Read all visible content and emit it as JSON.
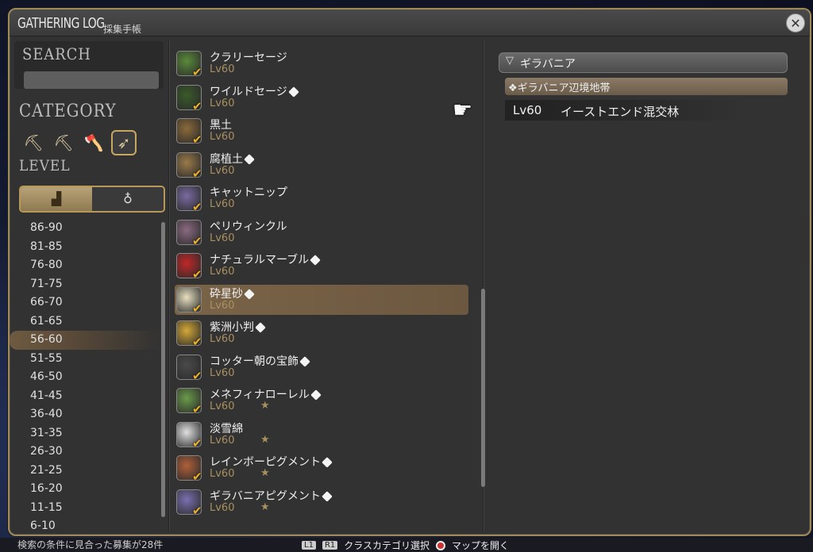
{
  "window": {
    "title": "GATHERING LOG",
    "subtitle": "採集手帳",
    "close_icon": "close-icon"
  },
  "search": {
    "label": "SEARCH",
    "placeholder": ""
  },
  "category": {
    "label": "CATEGORY",
    "icons": [
      "pickaxe-icon",
      "pickaxe-icon",
      "hatchet-icon",
      "sickle-icon"
    ],
    "active_index": 3
  },
  "level": {
    "label": "LEVEL",
    "toggle": {
      "left_icon": "stairs-icon",
      "right_icon": "bag-icon"
    },
    "ranges": [
      "86-90",
      "81-85",
      "76-80",
      "71-75",
      "66-70",
      "61-65",
      "56-60",
      "51-55",
      "46-50",
      "41-45",
      "36-40",
      "31-35",
      "26-30",
      "21-25",
      "16-20",
      "11-15",
      "6-10"
    ],
    "selected": "56-60"
  },
  "items": [
    {
      "name": "クラリーセージ",
      "lv": "Lv60",
      "icon_color": "#5a8a3a",
      "hidden": false,
      "star": false
    },
    {
      "name": "ワイルドセージ",
      "lv": "Lv60",
      "icon_color": "#3a5a2a",
      "hidden": true,
      "star": false
    },
    {
      "name": "黒土",
      "lv": "Lv60",
      "icon_color": "#8a6a3a",
      "hidden": false,
      "star": false
    },
    {
      "name": "腐植土",
      "lv": "Lv60",
      "icon_color": "#9a7a4a",
      "hidden": true,
      "star": false
    },
    {
      "name": "キャットニップ",
      "lv": "Lv60",
      "icon_color": "#7a6aa0",
      "hidden": false,
      "star": false
    },
    {
      "name": "ペリウィンクル",
      "lv": "Lv60",
      "icon_color": "#8a6a80",
      "hidden": false,
      "star": false
    },
    {
      "name": "ナチュラルマーブル",
      "lv": "Lv60",
      "icon_color": "#c02828",
      "hidden": true,
      "star": false
    },
    {
      "name": "砕星砂",
      "lv": "Lv60",
      "icon_color": "#e8e0c0",
      "hidden": true,
      "star": false
    },
    {
      "name": "紫洲小判",
      "lv": "Lv60",
      "icon_color": "#d4a838",
      "hidden": true,
      "star": false
    },
    {
      "name": "コッター朝の宝飾",
      "lv": "Lv60",
      "icon_color": "#4a4a4a",
      "hidden": true,
      "star": false
    },
    {
      "name": "メネフィナローレル",
      "lv": "Lv60",
      "icon_color": "#6a9a4a",
      "hidden": true,
      "star": true
    },
    {
      "name": "淡雪綿",
      "lv": "Lv60",
      "icon_color": "#e0e0e0",
      "hidden": false,
      "star": true
    },
    {
      "name": "レインボーピグメント",
      "lv": "Lv60",
      "icon_color": "#b0603a",
      "hidden": true,
      "star": true
    },
    {
      "name": "ギラバニアピグメント",
      "lv": "Lv60",
      "icon_color": "#7a70b0",
      "hidden": true,
      "star": true
    }
  ],
  "selected_item_index": 7,
  "star_glyph": "★",
  "check_glyph": "✔",
  "right": {
    "region": "ギラバニア",
    "subregion": "❖ギラバニア辺境地帯",
    "area_level": "Lv60",
    "area_name": "イーストエンド混交林"
  },
  "bottom": {
    "left_text": "検索の条件に見合った募集が28件",
    "hint_l1": "L1",
    "hint_r1": "R1",
    "hint_class": "クラスカテゴリ選択",
    "hint_map": "マップを開く"
  }
}
